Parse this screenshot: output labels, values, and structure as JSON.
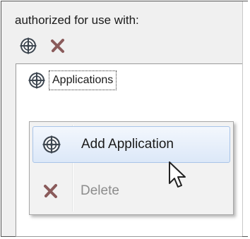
{
  "panel": {
    "title": "authorized for use with:"
  },
  "toolbar": {
    "add_icon": "target-add-icon",
    "delete_icon": "delete-x-icon"
  },
  "tree": {
    "items": [
      {
        "label": "Applications",
        "icon": "target-icon"
      }
    ]
  },
  "context_menu": {
    "items": [
      {
        "label": "Add Application",
        "icon": "target-icon",
        "state": "hover"
      },
      {
        "label": "Delete",
        "icon": "delete-x-icon",
        "state": "disabled"
      }
    ]
  },
  "colors": {
    "hover_border": "#a8c4e8",
    "disabled_text": "#8c8c8c",
    "delete_icon": "#8a5b5b"
  }
}
